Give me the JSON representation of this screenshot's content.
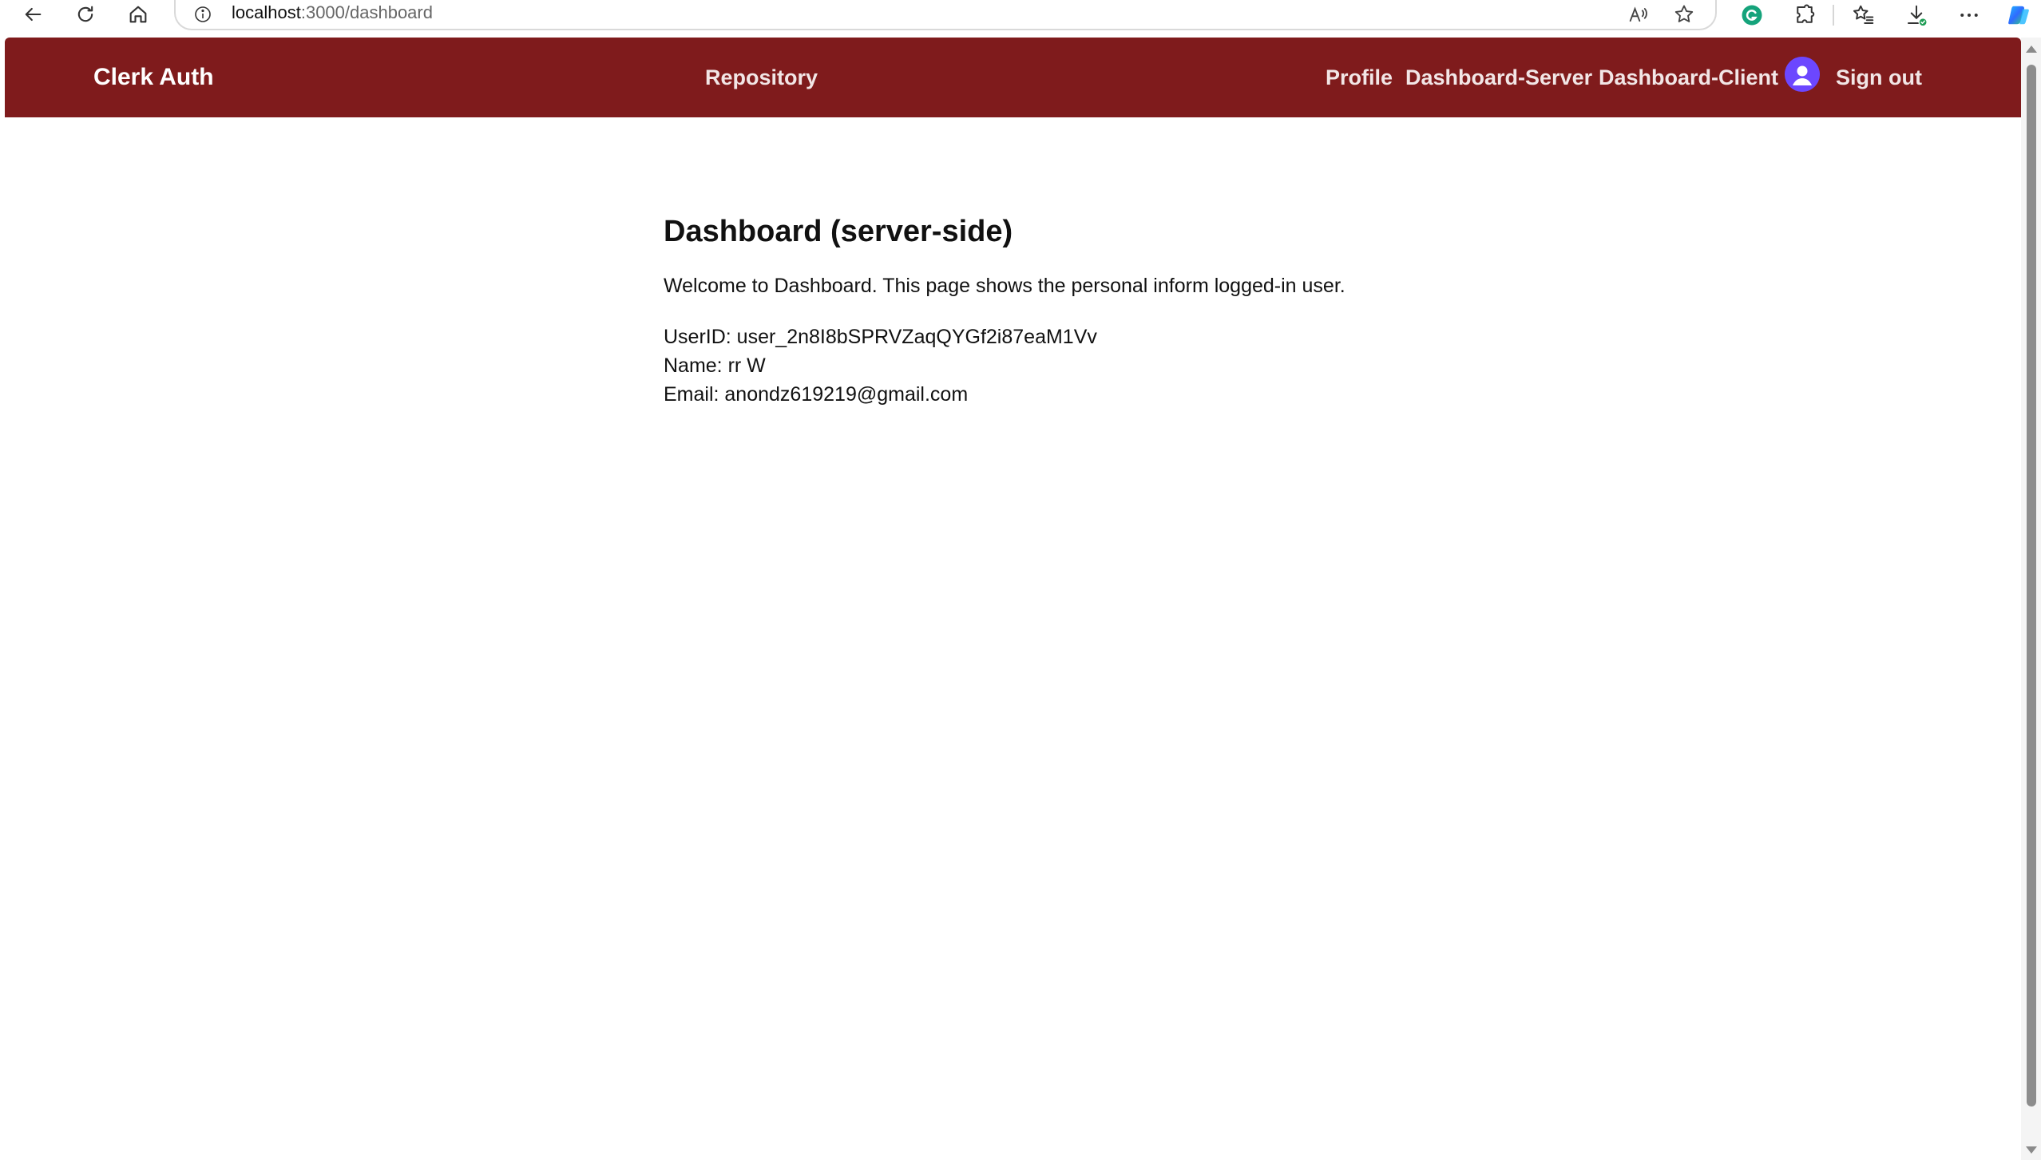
{
  "browser": {
    "url_host": "localhost",
    "url_path": ":3000/dashboard"
  },
  "header": {
    "brand": "Clerk Auth",
    "repository": "Repository",
    "profile": "Profile",
    "dashboard_server": "Dashboard-Server",
    "dashboard_client": "Dashboard-Client",
    "sign_out": "Sign out",
    "background_color": "#7f1b1c",
    "avatar_color": "#6c47ff"
  },
  "main": {
    "title": "Dashboard (server-side)",
    "welcome": "Welcome to Dashboard. This page shows the personal inform logged-in user.",
    "user_id_line": "UserID: user_2n8I8bSPRVZaqQYGf2i87eaM1Vv",
    "name_line": "Name: rr W",
    "email_line": "Email: anondz619219@gmail.com"
  },
  "icons": {
    "back": "back-arrow-icon",
    "reload": "reload-icon",
    "home": "home-icon",
    "info": "info-icon",
    "read_aloud": "read-aloud-icon",
    "favorite": "star-icon",
    "grammarly": "grammarly-icon",
    "extensions": "puzzle-icon",
    "favorites": "favorites-icon",
    "downloads": "download-icon",
    "more": "more-icon",
    "copilot": "copilot-icon",
    "avatar": "user-avatar-icon"
  }
}
